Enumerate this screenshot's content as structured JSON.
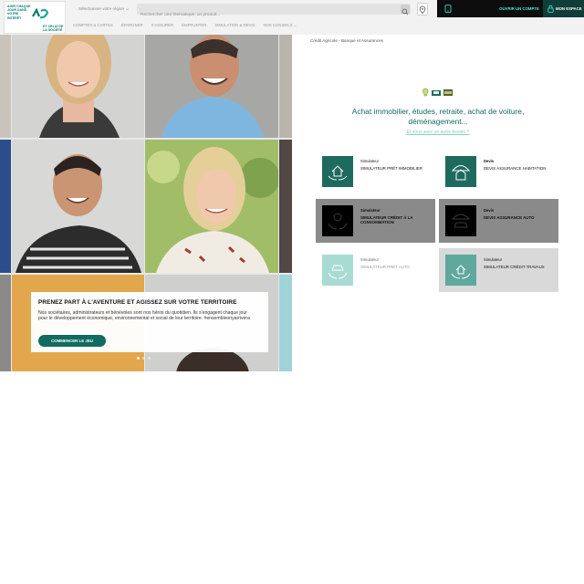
{
  "header": {
    "logo": {
      "slogan_left": "Agir chaque jour dans votre intérêt",
      "slogan_right": "et celui de la société"
    },
    "region_placeholder": "Sélectionner votre région",
    "search_placeholder": "Rechercher une thématique, un produit...",
    "contact_label": "",
    "open_account": "Ouvrir un compte",
    "my_space": "Mon espace",
    "nav": [
      "Comptes & cartes",
      "Épargner",
      "S'assurer",
      "Emprunter",
      "Simulation & devis",
      "Nos conseils"
    ]
  },
  "hero": {
    "title": "Prenez part à l'aventure et agissez sur votre territoire",
    "text": "Nos sociétaires, administrateurs et bénévoles sont nos héros du quotidien. Ils s'engagent chaque jour pour le développement économique, environnemental et social de leur territoire. #ensembleonyarrivera",
    "cta": "Commencer le jeu",
    "slides": 3,
    "active_slide": 1
  },
  "main": {
    "breadcrumb": "Crédit Agricole - Banque et Assurances",
    "headline": "Achat immobilier, études, retraite, achat de voiture, déménagement...",
    "subline": "Et vous avez un autre besoin ?",
    "cards": [
      {
        "kind": "Simulateur",
        "name": "Simulateur prêt immobilier",
        "icon": "house-hands-icon",
        "bg": "#ffffff",
        "tile": "#1f6a5e"
      },
      {
        "kind": "Devis",
        "name": "Devis assurance habitation",
        "icon": "umbrella-house-icon",
        "bg": "#ffffff",
        "tile": "#1f6a5e"
      },
      {
        "kind": "Simulateur",
        "name": "Simulateur crédit à la consommation",
        "icon": "hands-coins-icon",
        "bg": "#8a8a8a",
        "tile": "#000000"
      },
      {
        "kind": "Devis",
        "name": "Devis assurance auto",
        "icon": "umbrella-car-icon",
        "bg": "#8a8a8a",
        "tile": "#000000"
      },
      {
        "kind": "Simulateur",
        "name": "Simulateur prêt auto",
        "icon": "hands-car-icon",
        "bg": "#ffffff",
        "tile": "#a8dcd3"
      },
      {
        "kind": "Simulateur",
        "name": "Simulateur crédit travaux",
        "icon": "hands-house-icon",
        "bg": "#d9d9d9",
        "tile": "#5fa89c"
      }
    ]
  },
  "colors": {
    "brand": "#007a6d",
    "accent": "#3ff0d8",
    "dark": "#0d0d0d"
  }
}
